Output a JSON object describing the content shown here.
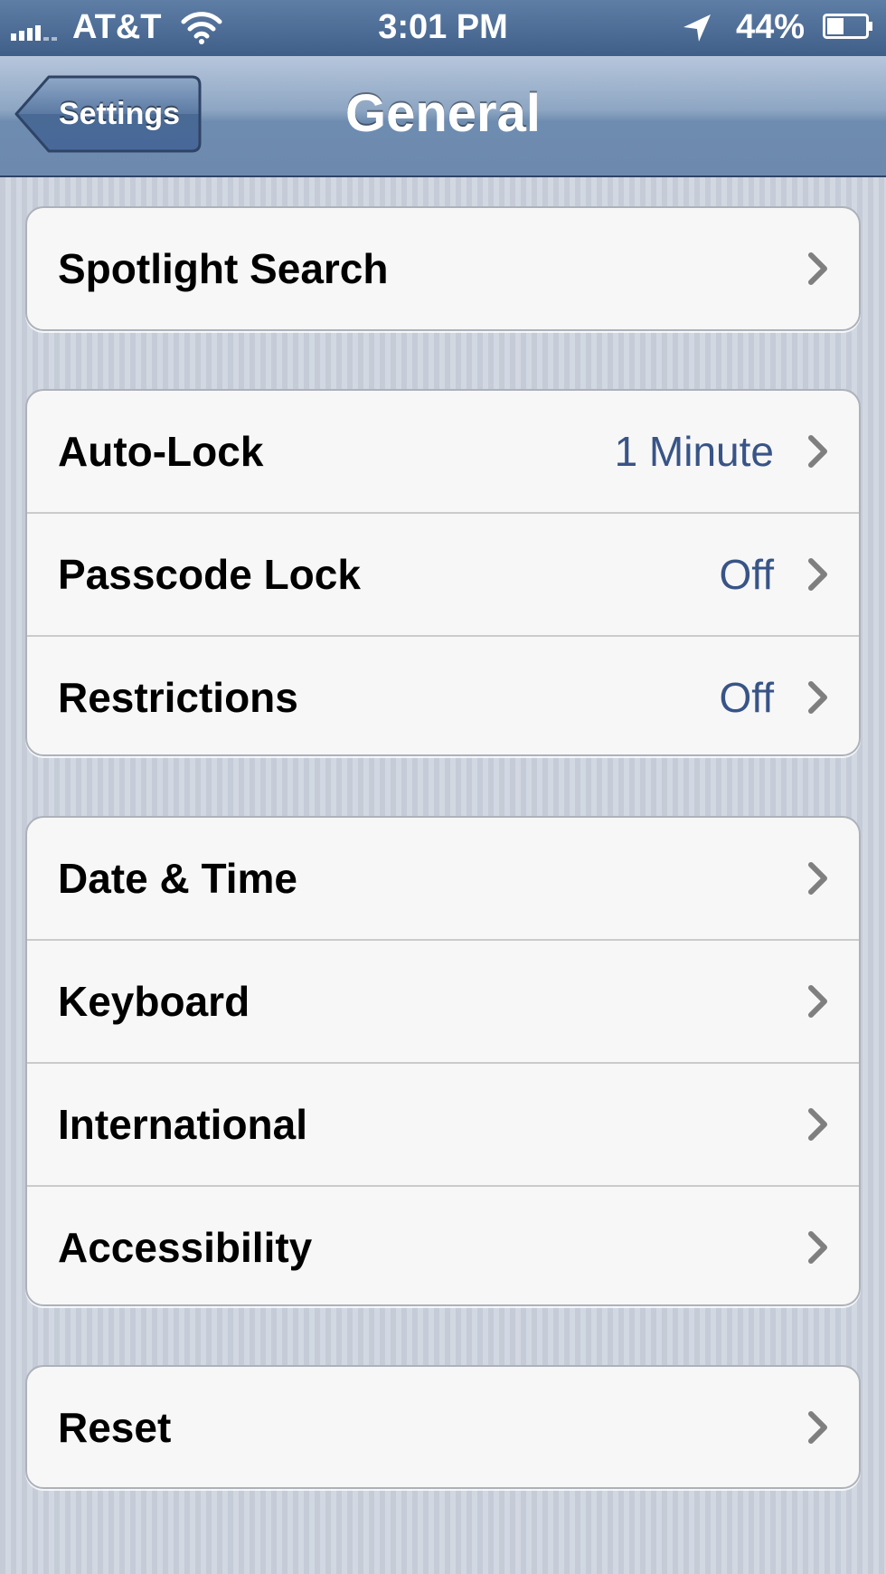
{
  "status_bar": {
    "carrier": "AT&T",
    "time": "3:01 PM",
    "battery_percent": "44%",
    "battery_level": 0.44,
    "signal_bars_filled": 4,
    "icons": [
      "signal-icon",
      "wifi-icon",
      "location-arrow-icon",
      "battery-icon"
    ]
  },
  "nav_bar": {
    "back_label": "Settings",
    "title": "General"
  },
  "groups": [
    {
      "rows": [
        {
          "label": "Spotlight Search",
          "value": ""
        }
      ]
    },
    {
      "rows": [
        {
          "label": "Auto-Lock",
          "value": "1 Minute"
        },
        {
          "label": "Passcode Lock",
          "value": "Off"
        },
        {
          "label": "Restrictions",
          "value": "Off"
        }
      ]
    },
    {
      "rows": [
        {
          "label": "Date & Time",
          "value": ""
        },
        {
          "label": "Keyboard",
          "value": ""
        },
        {
          "label": "International",
          "value": ""
        },
        {
          "label": "Accessibility",
          "value": ""
        }
      ]
    },
    {
      "rows": [
        {
          "label": "Reset",
          "value": ""
        }
      ]
    }
  ],
  "colors": {
    "value_text": "#385487",
    "nav_bar": "#6d8aae",
    "status_bar": "#3f5f89",
    "background": "#cbd2dd"
  }
}
